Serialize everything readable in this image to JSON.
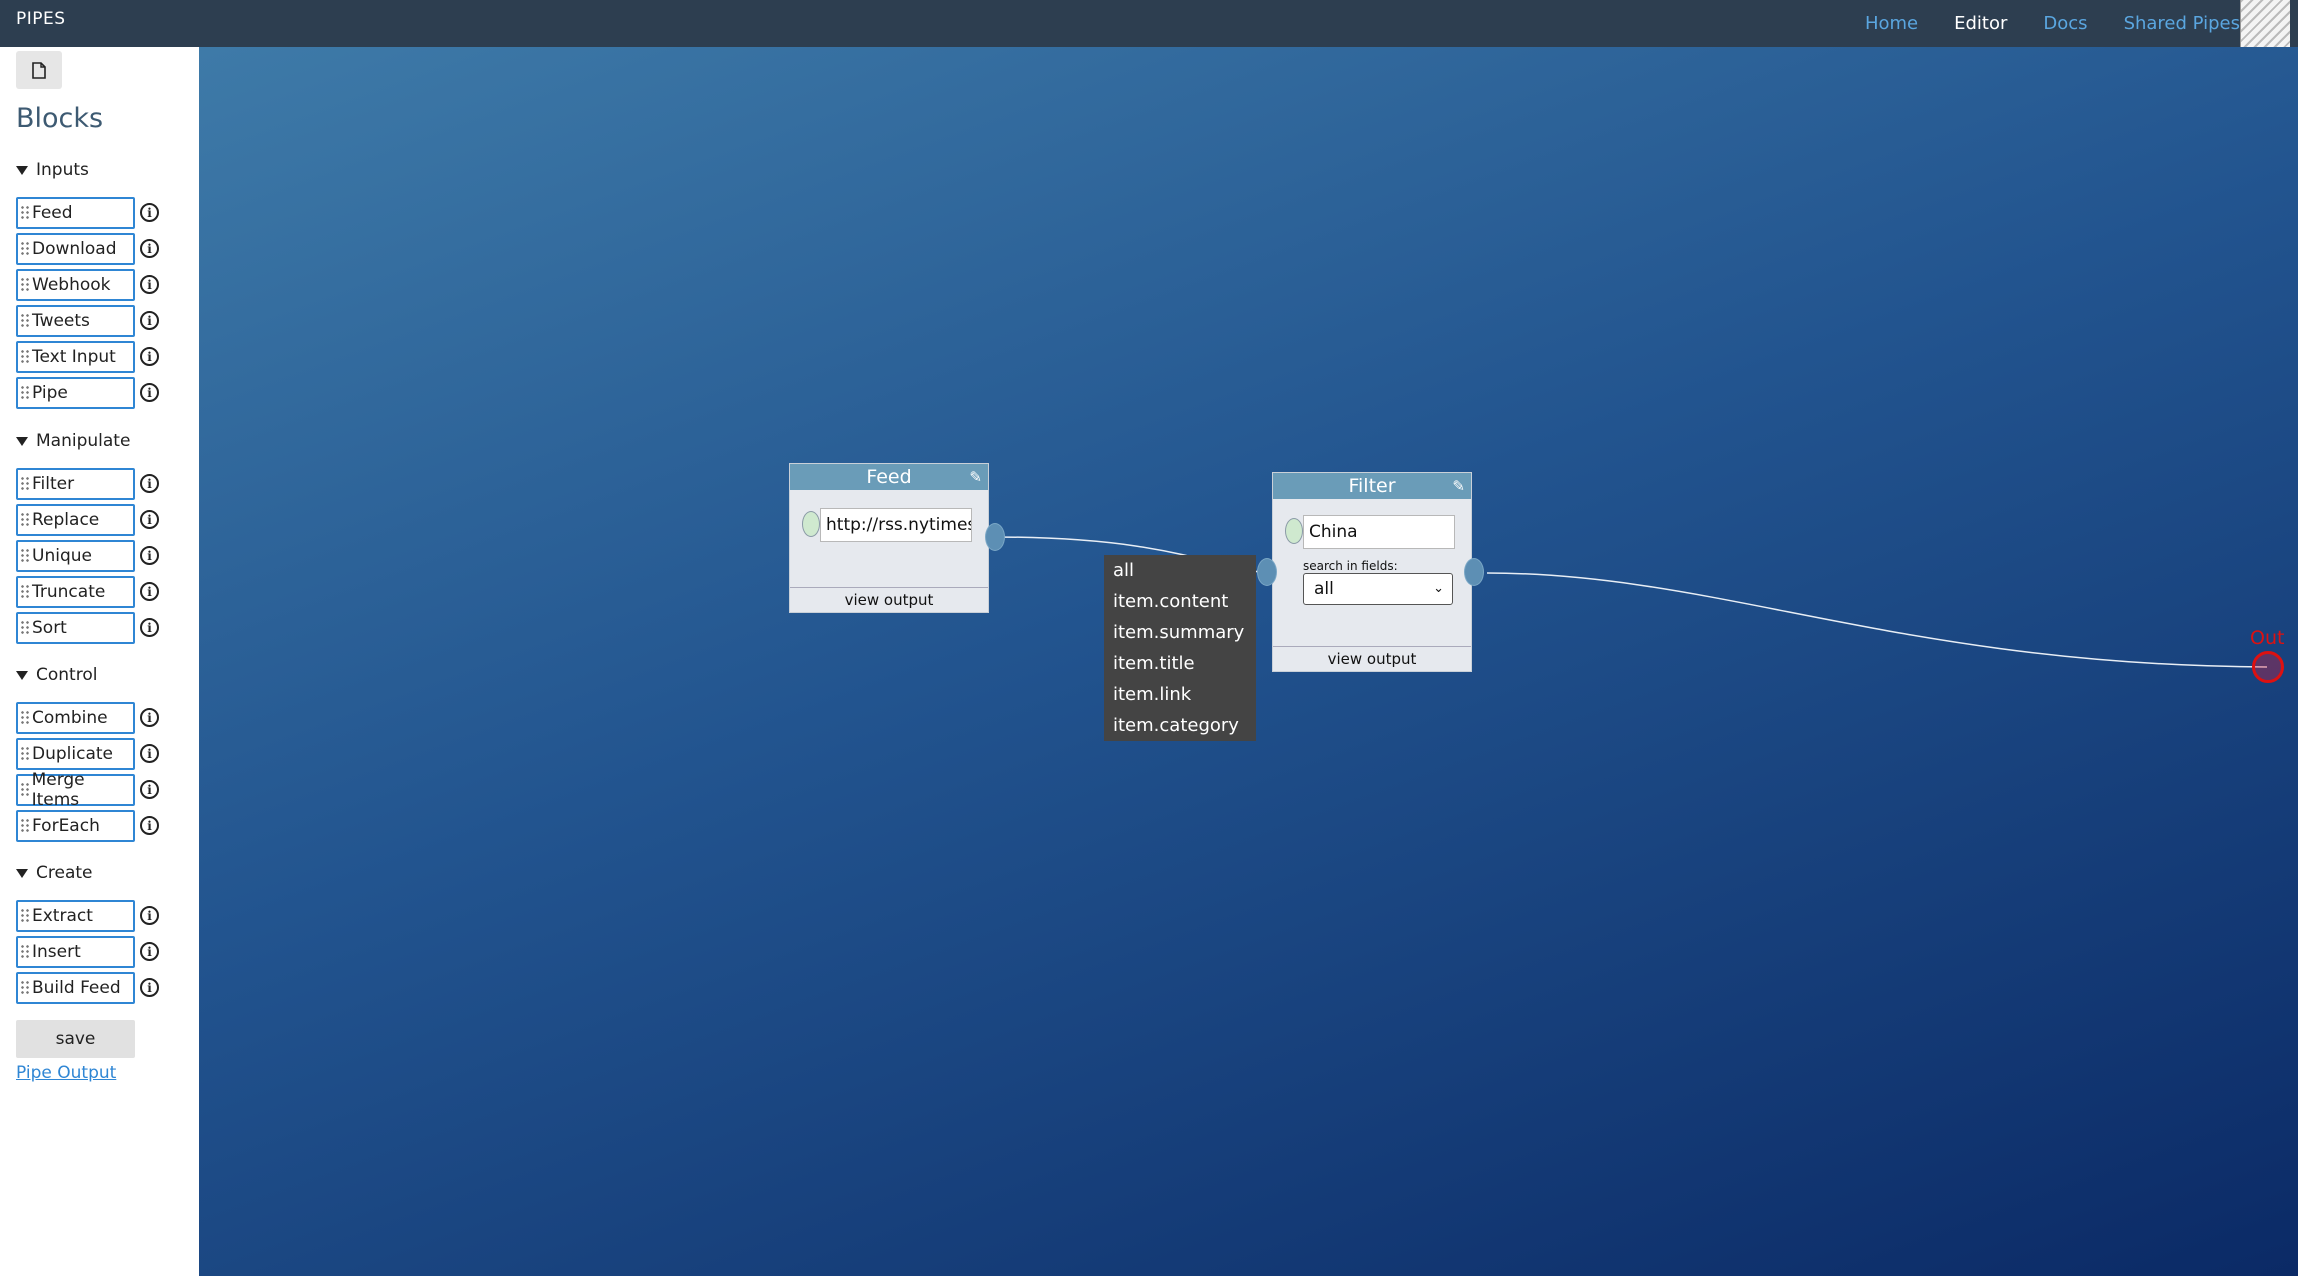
{
  "app": {
    "name": "PIPES"
  },
  "nav": {
    "items": [
      "Home",
      "Editor",
      "Docs",
      "Shared Pipes"
    ],
    "active": "Editor"
  },
  "sidebar": {
    "title": "Blocks",
    "sections": [
      {
        "name": "Inputs",
        "items": [
          "Feed",
          "Download",
          "Webhook",
          "Tweets",
          "Text Input",
          "Pipe"
        ]
      },
      {
        "name": "Manipulate",
        "items": [
          "Filter",
          "Replace",
          "Unique",
          "Truncate",
          "Sort"
        ]
      },
      {
        "name": "Control",
        "items": [
          "Combine",
          "Duplicate",
          "Merge Items",
          "ForEach"
        ]
      },
      {
        "name": "Create",
        "items": [
          "Extract",
          "Insert",
          "Build Feed"
        ]
      }
    ],
    "save_label": "save",
    "pipe_output_label": "Pipe Output"
  },
  "canvas": {
    "feed_block": {
      "title": "Feed",
      "url_value": "http://rss.nytimes",
      "footer": "view output"
    },
    "filter_block": {
      "title": "Filter",
      "query_value": "China",
      "search_label": "search in fields:",
      "selected_field": "all",
      "footer": "view output",
      "options": [
        "all",
        "item.content",
        "item.summary",
        "item.title",
        "item.link",
        "item.category"
      ]
    },
    "output": {
      "label": "Out"
    }
  },
  "colors": {
    "topbar": "#2d3e50",
    "nav_link": "#5aa6e0",
    "block_border": "#2f86d4",
    "block_header": "#6a9cb8",
    "output": "#dd1111"
  }
}
